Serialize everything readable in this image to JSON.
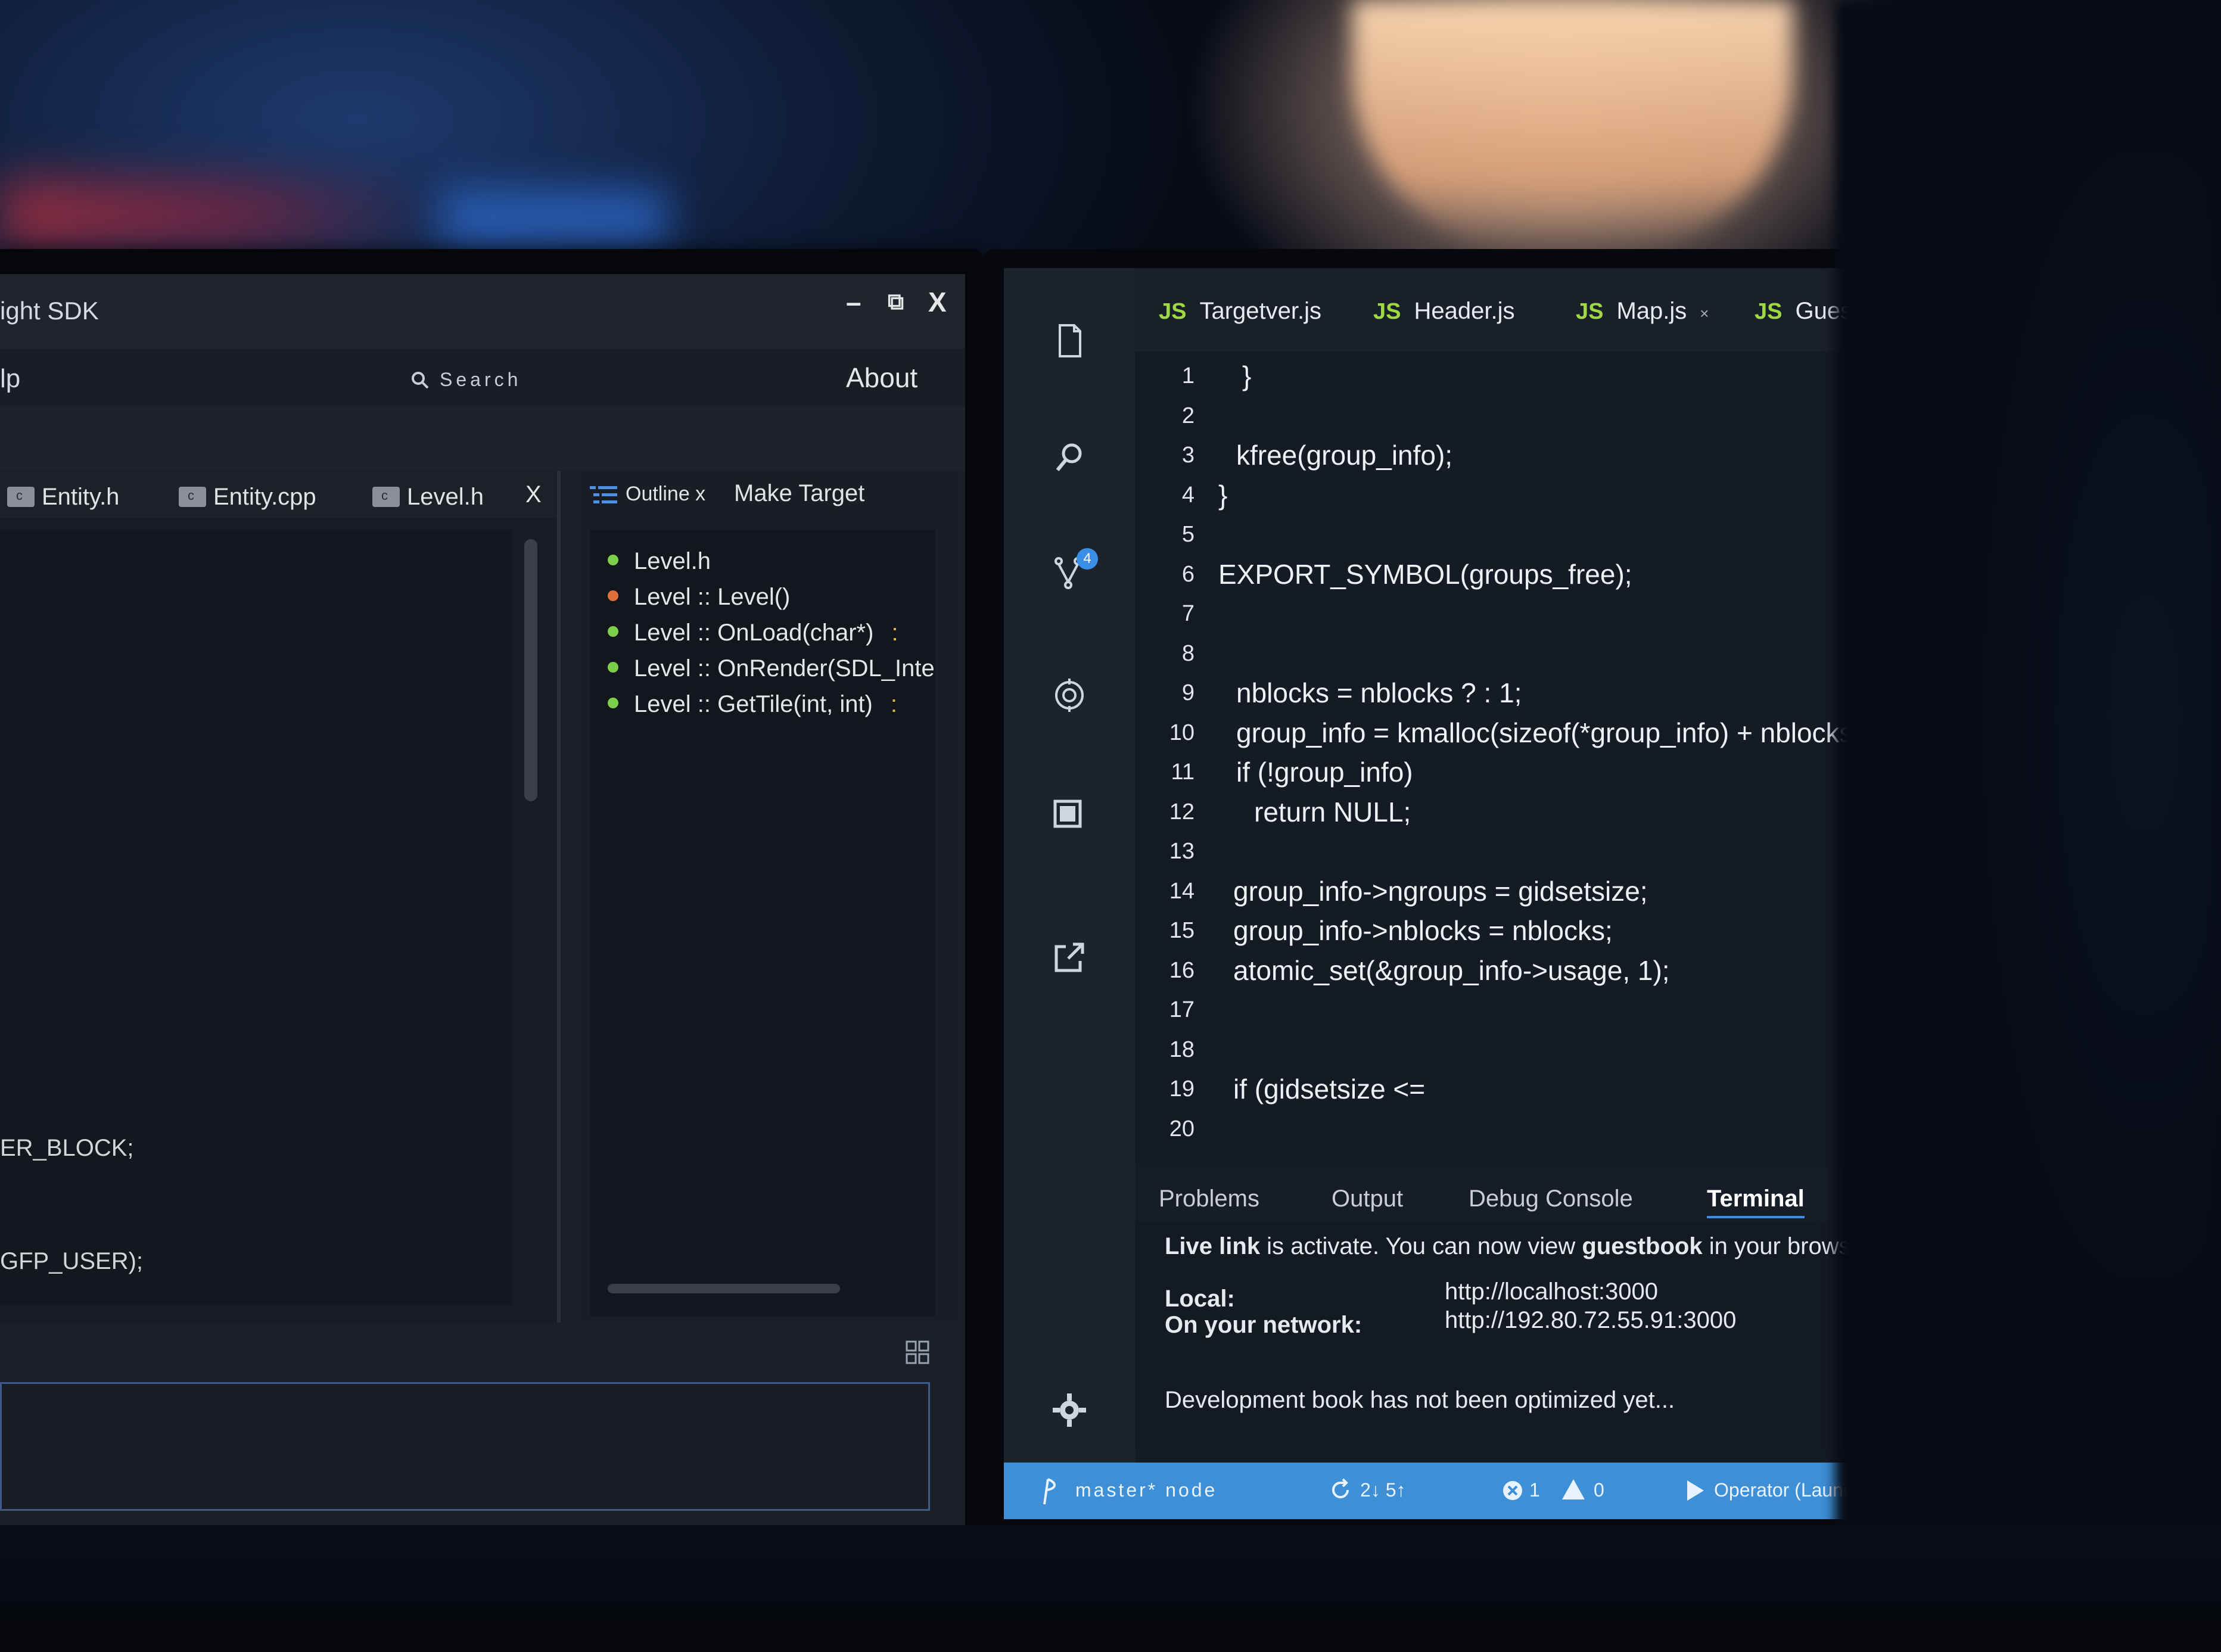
{
  "left_window": {
    "title": "ight SDK",
    "window_controls": {
      "minimize": "–",
      "restore": "⧉",
      "close": "X"
    },
    "menu": {
      "help": "lp",
      "search_placeholder": "Search",
      "about": "About"
    },
    "editor_tabs": [
      "Entity.h",
      "Entity.cpp",
      "Level.h"
    ],
    "editor_tab_close": "X",
    "code_lines": [
      "ER_BLOCK;",
      " GFP_USER);"
    ],
    "outline": {
      "tab_label": "Outline x",
      "make_target": "Make Target",
      "items": [
        {
          "label": "Level.h",
          "color": "#7ccf4a"
        },
        {
          "label": "Level :: Level()",
          "color": "#e0703a"
        },
        {
          "label": "Level :: OnLoad(char*)",
          "color": "#7ccf4a",
          "suffix": ":"
        },
        {
          "label": "Level :: OnRender(SDL_Inte",
          "color": "#7ccf4a"
        },
        {
          "label": "Level :: GetTile(int, int)",
          "color": "#7ccf4a",
          "suffix": ":"
        }
      ]
    }
  },
  "right_window": {
    "source_control_badge": "4",
    "tabs": [
      {
        "badge": "JS",
        "label": "Targetver.js"
      },
      {
        "badge": "JS",
        "label": "Header.js"
      },
      {
        "badge": "JS",
        "label": "Map.js",
        "close": "×"
      },
      {
        "badge": "JS",
        "label": "GuestGrid.js"
      }
    ],
    "line_numbers": [
      "1",
      "2",
      "3",
      "4",
      "5",
      "6",
      "7",
      "8",
      "9",
      "10",
      "11",
      "12",
      "13",
      "14",
      "15",
      "16",
      "17",
      "18",
      "19",
      "20"
    ],
    "code": [
      "}",
      "",
      "kfree(group_info);",
      "}",
      "",
      "EXPORT_SYMBOL(groups_free);",
      "",
      "",
      "nblocks = nblocks ? : 1;",
      "group_info = kmalloc(sizeof(*group_info) + nblocks",
      "if (!group_info)",
      "return NULL;",
      "",
      "group_info->ngroups = gidsetsize;",
      "group_info->nblocks = nblocks;",
      "atomic_set(&group_info->usage, 1);",
      "",
      "",
      "if (gidsetsize <=",
      ""
    ],
    "panel_tabs": [
      "Problems",
      "Output",
      "Debug Console",
      "Terminal"
    ],
    "terminal": {
      "line1_prefix": "Live link",
      "line1_mid": " is activate. You can now view ",
      "line1_bold": "guestbook",
      "line1_suffix": " in your brows",
      "local_label": "Local:",
      "local_url": "http://localhost:3000",
      "network_label": "On your network:",
      "network_url": "http://192.80.72.55.91:3000",
      "note": "Development book has not been optimized yet..."
    },
    "statusbar": {
      "branch": "master* node",
      "sync": "2↓  5↑",
      "errors": "1",
      "warnings": "0",
      "launch": "Operator (Launch)"
    }
  }
}
